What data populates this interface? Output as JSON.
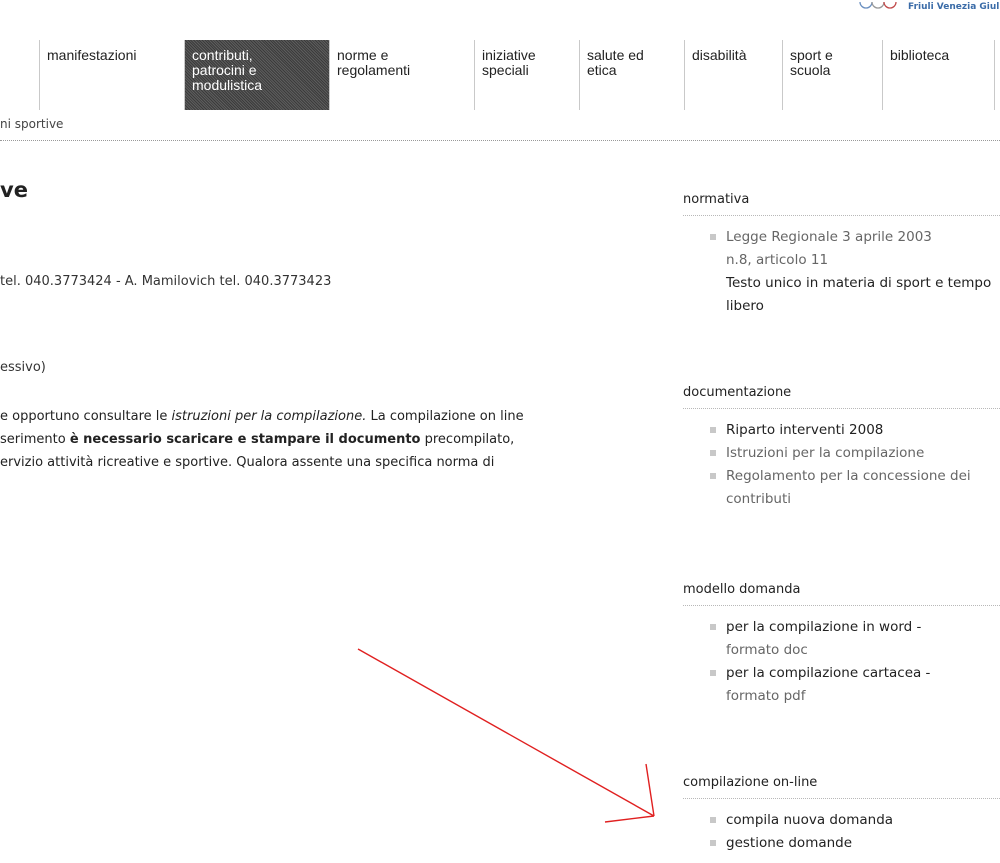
{
  "header": {
    "logo_text": "Friuli Venezia Giulia"
  },
  "nav": [
    {
      "label": "manifestazioni",
      "active": false
    },
    {
      "label": "contributi,\npatrocini e\nmodulistica",
      "active": true
    },
    {
      "label": "norme e\nregolamenti",
      "active": false
    },
    {
      "label": "iniziative\nspeciali",
      "active": false
    },
    {
      "label": "salute ed\netica",
      "active": false
    },
    {
      "label": "disabilità",
      "active": false
    },
    {
      "label": "sport e\nscuola",
      "active": false
    },
    {
      "label": "biblioteca",
      "active": false
    }
  ],
  "breadcrumb": "ni sportive",
  "main": {
    "title": "ve",
    "contacts": "tel. 040.3773424 - A. Mamilovich tel. 040.3773423",
    "note": "essivo)",
    "para": {
      "p1": "e opportuno consultare le ",
      "p1_em": "istruzioni per la compilazione.",
      "p1_end": " La compilazione on line",
      "p2": "serimento ",
      "p2_strong": "è necessario scaricare e stampare il documento",
      "p2_end": " precompilato,",
      "p3": "ervizio attività ricreative e sportive. Qualora assente una specifica norma di"
    }
  },
  "sidebar": {
    "normativa": {
      "title": "normativa",
      "link_line1": "Legge Regionale 3 aprile 2003",
      "link_line2": "n.8, articolo 11",
      "desc": "Testo unico in materia di sport e tempo libero"
    },
    "documentazione": {
      "title": "documentazione",
      "items": [
        {
          "label": "Riparto interventi 2008"
        },
        {
          "label": "Istruzioni per la compilazione"
        },
        {
          "label": "Regolamento per la concessione dei contributi"
        }
      ]
    },
    "modello": {
      "title": "modello domanda",
      "items": [
        {
          "label": "per la compilazione in word -",
          "sub": "formato doc"
        },
        {
          "label": "per la compilazione cartacea -",
          "sub": "formato pdf"
        }
      ]
    },
    "online": {
      "title": "compilazione on-line",
      "items": [
        {
          "label": "compila nuova domanda"
        },
        {
          "label": "gestione domande"
        }
      ]
    }
  },
  "colors": {
    "arrow": "#e02020",
    "active_nav": "#4a4a4a",
    "bullet": "#c8c8c8"
  },
  "icons": [
    "olympic-rings-logo",
    "square-bullet-icon",
    "red-arrow-annotation"
  ]
}
